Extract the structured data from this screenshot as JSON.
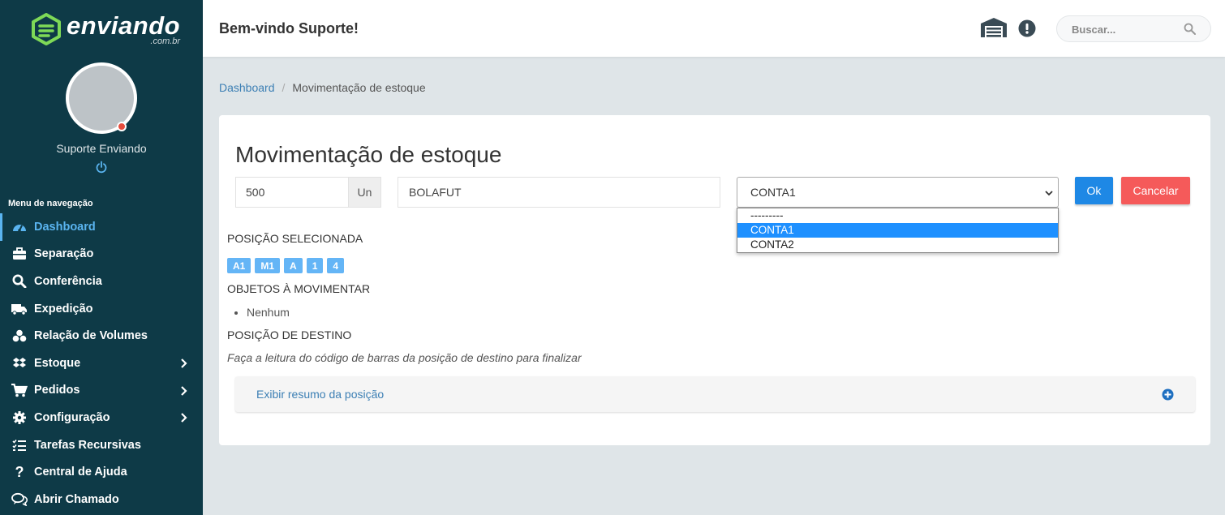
{
  "brand": {
    "name": "enviando",
    "suffix": ".com.br",
    "accent": "#7ed957"
  },
  "user": {
    "name": "Suporte Enviando",
    "status_color": "#e74c3c"
  },
  "sidebar": {
    "menu_title": "Menu de navegação",
    "items": [
      {
        "label": "Dashboard",
        "icon": "dashboard-icon",
        "active": true
      },
      {
        "label": "Separação",
        "icon": "briefcase-icon"
      },
      {
        "label": "Conferência",
        "icon": "search-icon"
      },
      {
        "label": "Expedição",
        "icon": "truck-icon"
      },
      {
        "label": "Relação de Volumes",
        "icon": "boxes-icon"
      },
      {
        "label": "Estoque",
        "icon": "dropbox-icon",
        "has_submenu": true
      },
      {
        "label": "Pedidos",
        "icon": "cart-icon",
        "has_submenu": true
      },
      {
        "label": "Configuração",
        "icon": "gear-icon",
        "has_submenu": true
      },
      {
        "label": "Tarefas Recursivas",
        "icon": "tasks-icon"
      },
      {
        "label": "Central de Ajuda",
        "icon": "question-icon"
      },
      {
        "label": "Abrir Chamado",
        "icon": "chat-icon"
      }
    ]
  },
  "header": {
    "welcome": "Bem-vindo Suporte!",
    "search_placeholder": "Buscar..."
  },
  "breadcrumb": {
    "home": "Dashboard",
    "separator": "/",
    "current": "Movimentação de estoque"
  },
  "main": {
    "title": "Movimentação de estoque",
    "quantity": "500",
    "unit": "Un",
    "product": "BOLAFUT",
    "account_selected": "CONTA1",
    "account_options": [
      "---------",
      "CONTA1",
      "CONTA2"
    ],
    "ok_label": "Ok",
    "cancel_label": "Cancelar",
    "selected_position_label": "POSIÇÃO SELECIONADA",
    "position_badges": [
      "A1",
      "M1",
      "A",
      "1",
      "4"
    ],
    "objects_label": "OBJETOS À MOVIMENTAR",
    "objects": [
      "Nenhum"
    ],
    "destination_label": "POSIÇÃO DE DESTINO",
    "destination_hint": "Faça a leitura do código de barras da posição de destino para finalizar",
    "summary_link": "Exibir resumo da posição"
  },
  "colors": {
    "sidebar_bg": "#0e3a47",
    "primary": "#1e88e5",
    "danger": "#f55a5a",
    "badge": "#64b5f6",
    "link": "#3c7fb4"
  }
}
